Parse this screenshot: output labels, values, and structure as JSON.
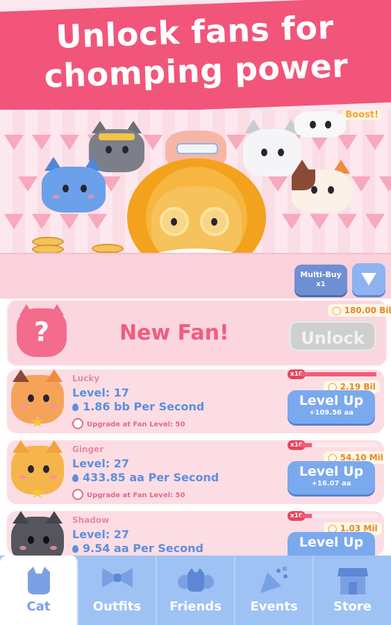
{
  "banner": {
    "title": "Unlock fans for\nchomping power"
  },
  "scene": {
    "boost_label": "Boost!"
  },
  "multibuy": {
    "label": "Multi-Buy",
    "value": "x1"
  },
  "new_fan": {
    "label": "New Fan!",
    "icon_text": "?",
    "price": "180.00 Bil",
    "unlock_label": "Unlock"
  },
  "fans": [
    {
      "name": "Lucky",
      "level": "Level: 17",
      "rate": "1.86 bb Per Second",
      "upgrade": "Upgrade at Fan Level: 50",
      "multiplier": "x10",
      "progress": 0.98,
      "price": "2.19 Bil",
      "levelup_label": "Level Up",
      "gain": "+109.56 aa",
      "color": "#f6a35a"
    },
    {
      "name": "Ginger",
      "level": "Level: 27",
      "rate": "433.85 aa Per Second",
      "upgrade": "Upgrade at Fan Level: 50",
      "multiplier": "x10",
      "progress": 0.15,
      "price": "54.10 Mil",
      "levelup_label": "Level Up",
      "gain": "+16.07 aa",
      "color": "#f6b54a"
    },
    {
      "name": "Shadow",
      "level": "Level: 27",
      "rate": "9.54 aa Per Second",
      "upgrade": "",
      "multiplier": "x10",
      "progress": 0.15,
      "price": "1.03 Mil",
      "levelup_label": "Level Up",
      "gain": "",
      "color": "#55555e"
    }
  ],
  "nav": {
    "tabs": [
      {
        "label": "Cat",
        "icon": "cat-icon",
        "active": true
      },
      {
        "label": "Outfits",
        "icon": "bowtie-icon",
        "active": false
      },
      {
        "label": "Friends",
        "icon": "friends-icon",
        "active": false
      },
      {
        "label": "Events",
        "icon": "party-popper-icon",
        "active": false
      },
      {
        "label": "Store",
        "icon": "store-icon",
        "active": false
      }
    ]
  },
  "colors": {
    "brand_pink": "#f2557a",
    "button_blue": "#7aa9ee",
    "nav_blue": "#9fc2f5",
    "coin_gold": "#f4c25c"
  }
}
